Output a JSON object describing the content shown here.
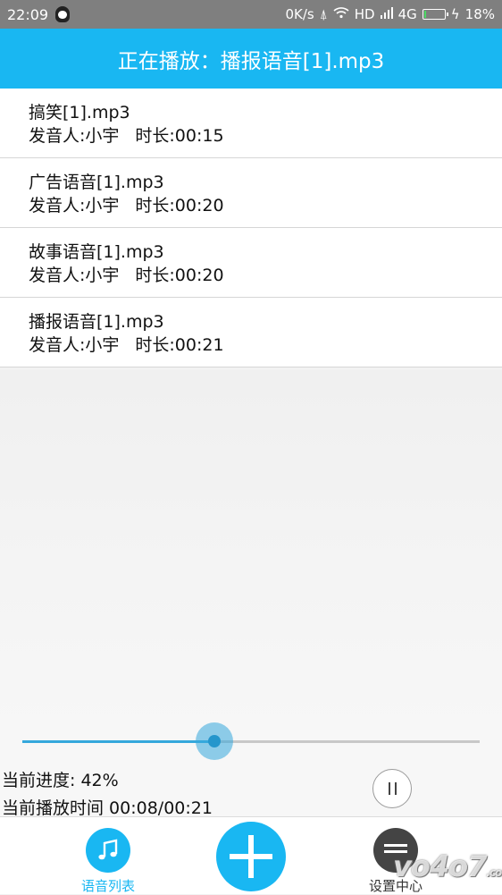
{
  "status_bar": {
    "time": "22:09",
    "speed": "0K/s",
    "network": "HD",
    "signal": "4G",
    "battery": "18%",
    "battery_level": 0.18
  },
  "header": {
    "prefix": "正在播放：",
    "track": "播报语音[1].mp3"
  },
  "tracks": [
    {
      "name": "搞笑[1].mp3",
      "speaker": "发音人:小宇",
      "duration": "时长:00:15"
    },
    {
      "name": "广告语音[1].mp3",
      "speaker": "发音人:小宇",
      "duration": "时长:00:20"
    },
    {
      "name": "故事语音[1].mp3",
      "speaker": "发音人:小宇",
      "duration": "时长:00:20"
    },
    {
      "name": "播报语音[1].mp3",
      "speaker": "发音人:小宇",
      "duration": "时长:00:21"
    }
  ],
  "player": {
    "progress_label": "当前进度: 42%",
    "progress": 0.42,
    "time_label": "当前播放时间 00:08/00:21"
  },
  "nav": {
    "list_label": "语音列表",
    "settings_label": "设置中心"
  },
  "colors": {
    "accent": "#19b7f2",
    "slider": "#35a8dc"
  },
  "watermark": "vo4o7",
  "watermark_domain": ".com"
}
